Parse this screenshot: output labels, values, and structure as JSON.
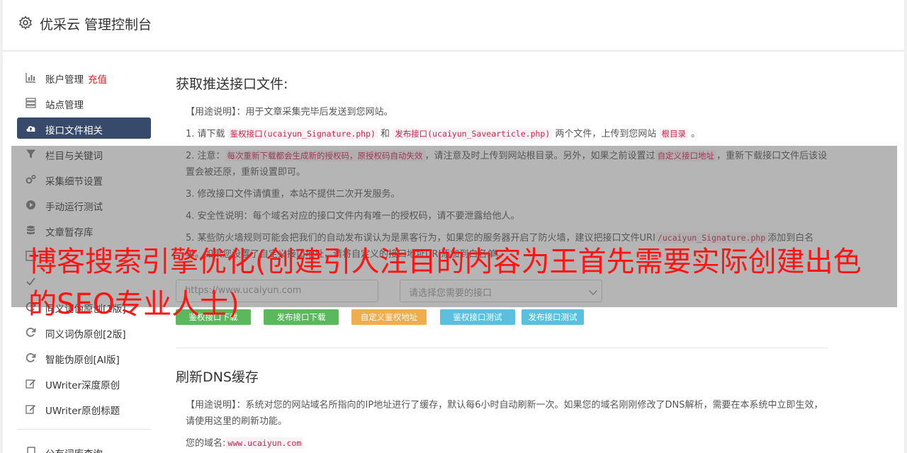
{
  "app": {
    "title": "优采云 管理控制台"
  },
  "sidebar": {
    "items": [
      {
        "label": "账户管理",
        "extra": "充值",
        "icon": "bar-chart-icon"
      },
      {
        "label": "站点管理",
        "icon": "server-icon"
      },
      {
        "label": "接口文件相关",
        "icon": "cloud-upload-icon",
        "active": true
      },
      {
        "label": "栏目与关键词",
        "icon": "filter-icon"
      },
      {
        "label": "采集细节设置",
        "icon": "cogs-icon"
      },
      {
        "label": "手动运行测试",
        "icon": "play-circle-icon"
      },
      {
        "label": "文章暂存库",
        "icon": "database-icon"
      },
      {
        "label": "",
        "icon": "list-icon"
      },
      {
        "label": "",
        "icon": "check-icon"
      },
      {
        "label": "同义词伪原创[1版]",
        "icon": "refresh-icon"
      },
      {
        "label": "同义词伪原创[2版]",
        "icon": "refresh-icon"
      },
      {
        "label": "智能伪原创[AI版]",
        "icon": "refresh-icon"
      },
      {
        "label": "UWriter深度原创",
        "icon": "edit-icon"
      },
      {
        "label": "UWriter原创标题",
        "icon": "edit-icon"
      }
    ],
    "bottom_items": [
      {
        "label": "公有词库查询",
        "icon": "book-icon"
      }
    ]
  },
  "section1": {
    "title": "获取推送接口文件:",
    "usage_label": "【用途说明】",
    "usage_text": "：用于文章采集完毕后发送到您网站。",
    "p1_a": "1. 请下载 ",
    "p1_code1": "鉴权接口(ucaiyun_Signature.php)",
    "p1_b": " 和 ",
    "p1_code2": "发布接口(ucaiyun_Savearticle.php)",
    "p1_c": " 两个文件，上传到您网站 ",
    "p1_code3": "根目录",
    "p1_d": " 。",
    "p2_a": "2. 注意：",
    "p2_code1": "每次重新下载都会生成新的授权码，原授权码自动失效",
    "p2_b": "，请注意及时上传到网站根目录。另外，如果之前设置过",
    "p2_code2": "自定义接口地址",
    "p2_c": "，重新下载接口文件后该设置会被还原，重新设置即可。",
    "p3": "3. 修改接口文件请慎重，本站不提供二次开发服务。",
    "p4": "4. 安全性说明：每个域名对应的接口文件内有唯一的授权码，请不要泄露给他人。",
    "p5_a": "5. 某些防火墙规则可能会把我们的自动发布误认为是黑客行为，如果您的服务器开启了防火墙，建议把接口文件URI",
    "p5_code1": "/ucaiyun_Signature.php",
    "p5_b": "添加到白名单。如果您设置了自定义接口地址，请将自定义的接口地址URI添加到白名单。",
    "url_placeholder": "https://www.ucaiyun.com",
    "select_placeholder": "请选择您需要的接口",
    "buttons": {
      "download_auth": "鉴权接口下载",
      "download_publish": "发布接口下载",
      "custom_auth": "自定义鉴权地址",
      "test_auth": "鉴权接口测试",
      "test_publish": "发布接口测试"
    }
  },
  "section2": {
    "title": "刷新DNS缓存",
    "usage_label": "【用途说明】",
    "usage_text": "：系统对您的网站域名所指向的IP地址进行了缓存，默认每6小时自动刷新一次。如果您的域名刚刚修改了DNS解析，需要在本系统中立即生效，请使用这里的刷新功能。",
    "domain_label": "您的域名:",
    "domain_value": "www.ucaiyun.com"
  },
  "overlay_text": "博客搜索引擎优化(创建引人注目的内容为王首先需要实际创建出色的SEO专业人士)",
  "colors": {
    "active_nav": "#374a6b",
    "accent_red": "#e02020",
    "overlay_text": "#ff1414"
  }
}
